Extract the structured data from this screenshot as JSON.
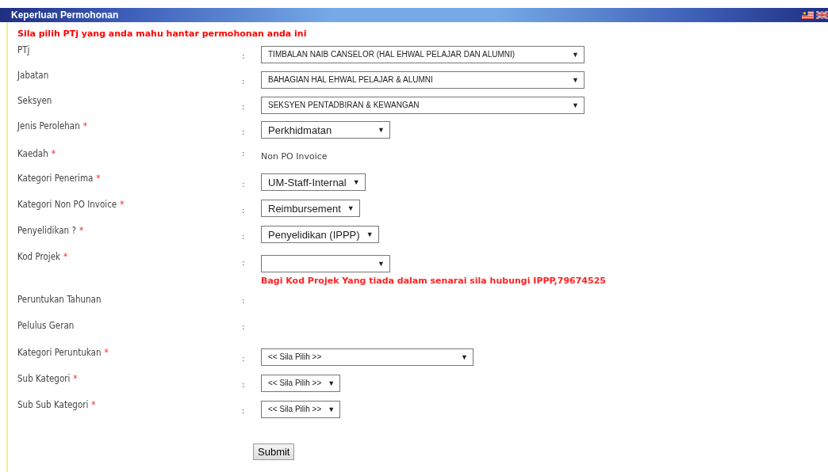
{
  "header": {
    "title": "Keperluan Permohonan"
  },
  "intro": "Sila pilih PTj yang anda mahu hantar permohonan anda ini",
  "fields": [
    {
      "label": "PTj",
      "required": false,
      "kind": "select",
      "value": "TIMBALAN NAIB CANSELOR (HAL EHWAL PELAJAR DAN ALUMNI)"
    },
    {
      "label": "Jabatan",
      "required": false,
      "kind": "select",
      "value": "BAHAGIAN HAL EHWAL PELAJAR & ALUMNI"
    },
    {
      "label": "Seksyen",
      "required": false,
      "kind": "select",
      "value": "SEKSYEN PENTADBIRAN & KEWANGAN"
    },
    {
      "label": "Jenis Perolehan",
      "required": true,
      "kind": "select",
      "value": "Perkhidmatan"
    },
    {
      "label": "Kaedah",
      "required": true,
      "kind": "text",
      "value": "Non PO Invoice"
    },
    {
      "label": "Kategori Penerima",
      "required": true,
      "kind": "select",
      "value": "UM-Staff-Internal"
    },
    {
      "label": "Kategori Non PO Invoice",
      "required": true,
      "kind": "select",
      "value": "Reimbursement"
    },
    {
      "label": "Penyelidikan ?",
      "required": true,
      "kind": "select",
      "value": "Penyelidikan (IPPP)"
    },
    {
      "label": "Kod Projek",
      "required": true,
      "kind": "select",
      "note": "Bagi Kod Projek Yang tiada dalam senarai sila hubungi IPPP,79674525"
    },
    {
      "label": "Peruntukan Tahunan",
      "required": false,
      "kind": "empty"
    },
    {
      "label": "Pelulus Geran",
      "required": false,
      "kind": "empty"
    },
    {
      "label": "Kategori Peruntukan",
      "required": true,
      "kind": "select",
      "value": "<< Sila Pilih >>"
    },
    {
      "label": "Sub Kategori",
      "required": true,
      "kind": "select",
      "value": "<< Sila Pilih >>"
    },
    {
      "label": "Sub Sub Kategori",
      "required": true,
      "kind": "select",
      "value": "<< Sila Pilih >>"
    }
  ],
  "colon": ":",
  "arrow": "▼",
  "required_mark": "*",
  "submit": "Submit"
}
